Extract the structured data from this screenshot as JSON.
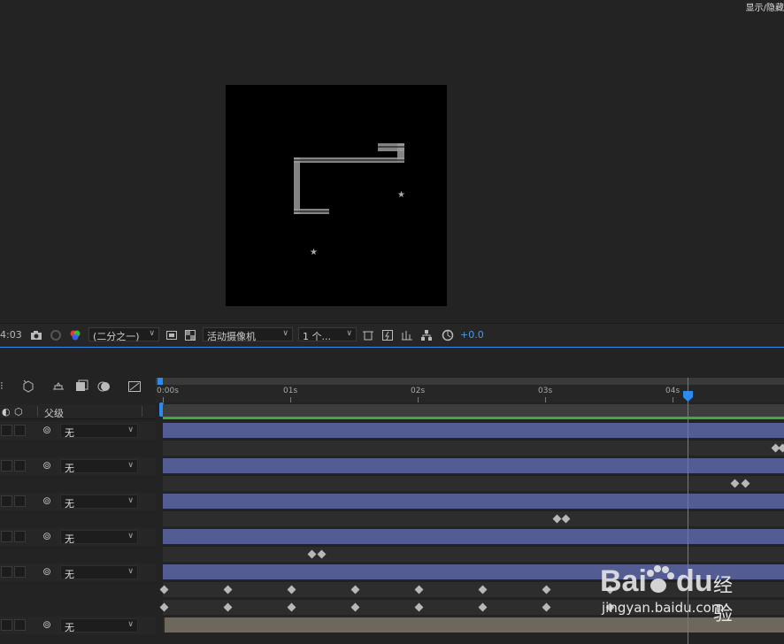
{
  "viewer": {
    "top_right_text": "显示/隐藏"
  },
  "toolbar": {
    "timecode": "4:03",
    "resolution": "(二分之一)",
    "camera": "活动摄像机",
    "views": "1 个...",
    "exposure": "+0.0",
    "accent": "#2d8ceb"
  },
  "timeline": {
    "parent_header": "父级",
    "ruler": [
      "0:00s",
      "01s",
      "02s",
      "03s",
      "04s"
    ],
    "layers": [
      {
        "parent": "无",
        "track": "blue"
      },
      {
        "parent": "无",
        "track": "blue"
      },
      {
        "parent": "无",
        "track": "blue"
      },
      {
        "parent": "无",
        "track": "blue"
      },
      {
        "parent": "无",
        "track": "blue"
      },
      {
        "parent": "无",
        "track": "tan"
      }
    ],
    "playhead_color": "#2d8ceb",
    "layer_track_color": "#545c94"
  },
  "watermark": {
    "brand": "Bai",
    "brand2": "du",
    "cn": "经验",
    "url": "jingyan.baidu.com"
  }
}
